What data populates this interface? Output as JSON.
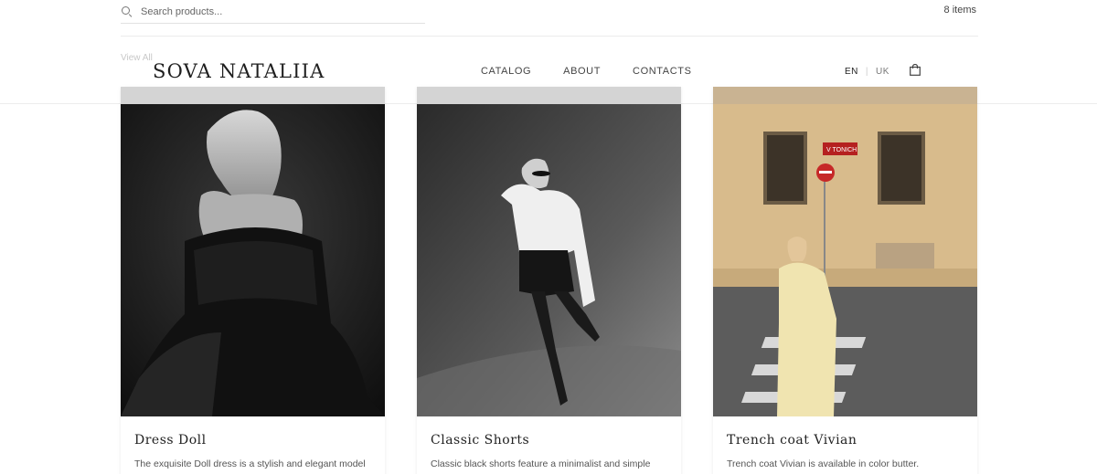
{
  "search": {
    "placeholder": "Search products...",
    "items_count": "8 items"
  },
  "view_all": "View All",
  "header": {
    "logo": "SOVA NATALIIA",
    "nav": [
      "CATALOG",
      "ABOUT",
      "CONTACTS"
    ],
    "lang_en": "EN",
    "lang_sep": "|",
    "lang_uk": "UK"
  },
  "products": [
    {
      "title": "Dress Doll",
      "description": "The exquisite Doll dress is a stylish and elegant model"
    },
    {
      "title": "Classic Shorts",
      "description": "Classic black shorts feature a minimalist and simple"
    },
    {
      "title": "Trench coat Vivian",
      "description": "Trench coat Vivian is available in color butter."
    }
  ],
  "street_sign": "V TONICH",
  "icons": [
    "search-icon",
    "shopping-bag-icon"
  ]
}
